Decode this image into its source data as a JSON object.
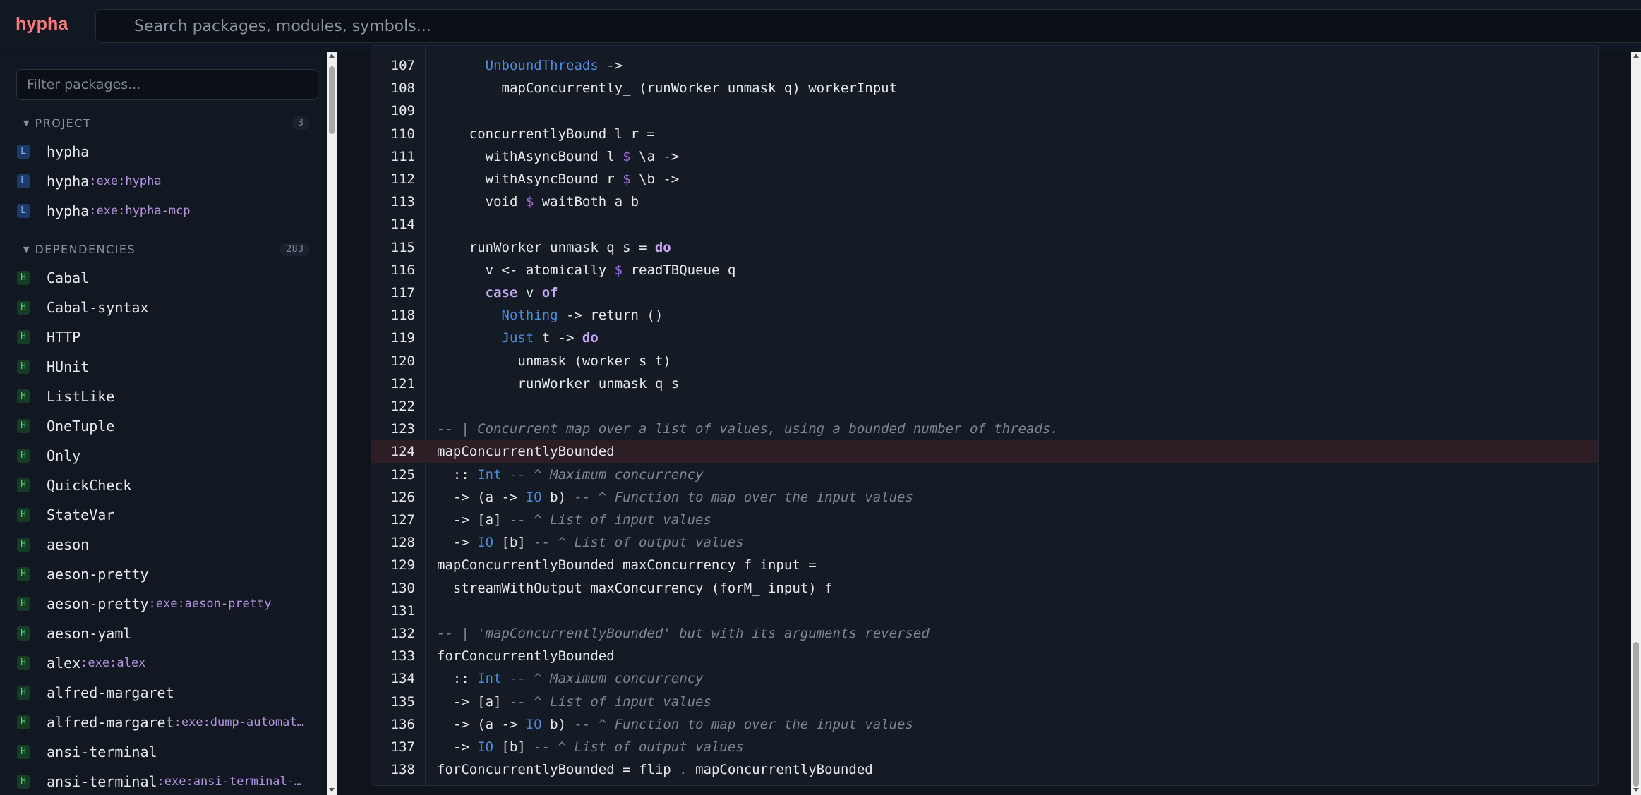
{
  "app": {
    "logo": "hypha"
  },
  "search": {
    "placeholder": "Search packages, modules, symbols..."
  },
  "sidebar": {
    "filter_placeholder": "Filter packages...",
    "project": {
      "title": "PROJECT",
      "count": "3",
      "items": [
        {
          "badge": "L",
          "name": "hypha",
          "exe": ""
        },
        {
          "badge": "L",
          "name": "hypha",
          "exe": ":exe:hypha"
        },
        {
          "badge": "L",
          "name": "hypha",
          "exe": ":exe:hypha-mcp"
        }
      ]
    },
    "dependencies": {
      "title": "DEPENDENCIES",
      "count": "283",
      "items": [
        {
          "badge": "H",
          "name": "Cabal",
          "exe": ""
        },
        {
          "badge": "H",
          "name": "Cabal-syntax",
          "exe": ""
        },
        {
          "badge": "H",
          "name": "HTTP",
          "exe": ""
        },
        {
          "badge": "H",
          "name": "HUnit",
          "exe": ""
        },
        {
          "badge": "H",
          "name": "ListLike",
          "exe": ""
        },
        {
          "badge": "H",
          "name": "OneTuple",
          "exe": ""
        },
        {
          "badge": "H",
          "name": "Only",
          "exe": ""
        },
        {
          "badge": "H",
          "name": "QuickCheck",
          "exe": ""
        },
        {
          "badge": "H",
          "name": "StateVar",
          "exe": ""
        },
        {
          "badge": "H",
          "name": "aeson",
          "exe": ""
        },
        {
          "badge": "H",
          "name": "aeson-pretty",
          "exe": ""
        },
        {
          "badge": "H",
          "name": "aeson-pretty",
          "exe": ":exe:aeson-pretty"
        },
        {
          "badge": "H",
          "name": "aeson-yaml",
          "exe": ""
        },
        {
          "badge": "H",
          "name": "alex",
          "exe": ":exe:alex"
        },
        {
          "badge": "H",
          "name": "alfred-margaret",
          "exe": ""
        },
        {
          "badge": "H",
          "name": "alfred-margaret",
          "exe": ":exe:dump-automat…"
        },
        {
          "badge": "H",
          "name": "ansi-terminal",
          "exe": ""
        },
        {
          "badge": "H",
          "name": "ansi-terminal",
          "exe": ":exe:ansi-terminal-…"
        }
      ]
    }
  },
  "code": {
    "highlighted_line": 124,
    "lines": [
      {
        "n": "107",
        "t": [
          [
            "      ",
            ""
          ],
          [
            "UnboundThreads",
            "ty"
          ],
          [
            " ->",
            ""
          ]
        ]
      },
      {
        "n": "108",
        "t": [
          [
            "        mapConcurrently_ (runWorker unmask q) workerInput",
            ""
          ]
        ]
      },
      {
        "n": "109",
        "t": []
      },
      {
        "n": "110",
        "t": [
          [
            "    concurrentlyBound l r =",
            ""
          ]
        ]
      },
      {
        "n": "111",
        "t": [
          [
            "      withAsyncBound l ",
            ""
          ],
          [
            "$",
            "op"
          ],
          [
            " \\a ->",
            ""
          ]
        ]
      },
      {
        "n": "112",
        "t": [
          [
            "      withAsyncBound r ",
            ""
          ],
          [
            "$",
            "op"
          ],
          [
            " \\b ->",
            ""
          ]
        ]
      },
      {
        "n": "113",
        "t": [
          [
            "      void ",
            ""
          ],
          [
            "$",
            "op"
          ],
          [
            " waitBoth a b",
            ""
          ]
        ]
      },
      {
        "n": "114",
        "t": []
      },
      {
        "n": "115",
        "t": [
          [
            "    runWorker unmask q s = ",
            ""
          ],
          [
            "do",
            "kw"
          ]
        ]
      },
      {
        "n": "116",
        "t": [
          [
            "      v <- atomically ",
            ""
          ],
          [
            "$",
            "op"
          ],
          [
            " readTBQueue q",
            ""
          ]
        ]
      },
      {
        "n": "117",
        "t": [
          [
            "      ",
            ""
          ],
          [
            "case",
            "kw"
          ],
          [
            " v ",
            ""
          ],
          [
            "of",
            "kw"
          ]
        ]
      },
      {
        "n": "118",
        "t": [
          [
            "        ",
            ""
          ],
          [
            "Nothing",
            "ty"
          ],
          [
            " -> return ()",
            ""
          ]
        ]
      },
      {
        "n": "119",
        "t": [
          [
            "        ",
            ""
          ],
          [
            "Just",
            "ty"
          ],
          [
            " t -> ",
            ""
          ],
          [
            "do",
            "kw"
          ]
        ]
      },
      {
        "n": "120",
        "t": [
          [
            "          unmask (worker s t)",
            ""
          ]
        ]
      },
      {
        "n": "121",
        "t": [
          [
            "          runWorker unmask q s",
            ""
          ]
        ]
      },
      {
        "n": "122",
        "t": []
      },
      {
        "n": "123",
        "t": [
          [
            "-- | Concurrent map over a list of values, using a bounded number of threads.",
            "cm"
          ]
        ]
      },
      {
        "n": "124",
        "t": [
          [
            "mapConcurrentlyBounded",
            ""
          ]
        ]
      },
      {
        "n": "125",
        "t": [
          [
            "  :: ",
            ""
          ],
          [
            "Int",
            "ty"
          ],
          [
            " ",
            ""
          ],
          [
            "-- ^ Maximum concurrency",
            "cm"
          ]
        ]
      },
      {
        "n": "126",
        "t": [
          [
            "  -> (a -> ",
            ""
          ],
          [
            "IO",
            "ty"
          ],
          [
            " b) ",
            ""
          ],
          [
            "-- ^ Function to map over the input values",
            "cm"
          ]
        ]
      },
      {
        "n": "127",
        "t": [
          [
            "  -> [a] ",
            ""
          ],
          [
            "-- ^ List of input values",
            "cm"
          ]
        ]
      },
      {
        "n": "128",
        "t": [
          [
            "  -> ",
            ""
          ],
          [
            "IO",
            "ty"
          ],
          [
            " [b] ",
            ""
          ],
          [
            "-- ^ List of output values",
            "cm"
          ]
        ]
      },
      {
        "n": "129",
        "t": [
          [
            "mapConcurrentlyBounded maxConcurrency f input =",
            ""
          ]
        ]
      },
      {
        "n": "130",
        "t": [
          [
            "  streamWithOutput maxConcurrency (forM_ input) f",
            ""
          ]
        ]
      },
      {
        "n": "131",
        "t": []
      },
      {
        "n": "132",
        "t": [
          [
            "-- | 'mapConcurrentlyBounded' but with its arguments reversed",
            "cm"
          ]
        ]
      },
      {
        "n": "133",
        "t": [
          [
            "forConcurrentlyBounded",
            ""
          ]
        ]
      },
      {
        "n": "134",
        "t": [
          [
            "  :: ",
            ""
          ],
          [
            "Int",
            "ty"
          ],
          [
            " ",
            ""
          ],
          [
            "-- ^ Maximum concurrency",
            "cm"
          ]
        ]
      },
      {
        "n": "135",
        "t": [
          [
            "  -> [a] ",
            ""
          ],
          [
            "-- ^ List of input values",
            "cm"
          ]
        ]
      },
      {
        "n": "136",
        "t": [
          [
            "  -> (a -> ",
            ""
          ],
          [
            "IO",
            "ty"
          ],
          [
            " b) ",
            ""
          ],
          [
            "-- ^ Function to map over the input values",
            "cm"
          ]
        ]
      },
      {
        "n": "137",
        "t": [
          [
            "  -> ",
            ""
          ],
          [
            "IO",
            "ty"
          ],
          [
            " [b] ",
            ""
          ],
          [
            "-- ^ List of output values",
            "cm"
          ]
        ]
      },
      {
        "n": "138",
        "t": [
          [
            "forConcurrentlyBounded = flip ",
            ""
          ],
          [
            ".",
            "op"
          ],
          [
            " mapConcurrentlyBounded",
            ""
          ]
        ]
      }
    ]
  }
}
